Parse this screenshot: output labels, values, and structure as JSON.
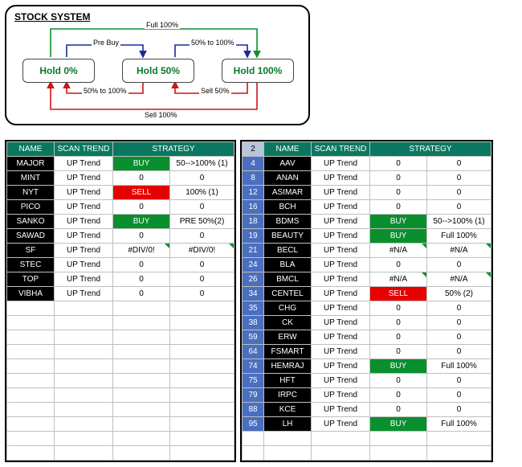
{
  "diagram": {
    "title": "STOCK SYSTEM",
    "states": [
      "Hold 0%",
      "Hold 50%",
      "Hold 100%"
    ],
    "labels": {
      "full": "Full 100%",
      "prebuy": "Pre Buy",
      "fifty_to_hundred_top": "50% to 100%",
      "fifty_to_hundred_bottom": "50% to 100%",
      "sell50": "Sell 50%",
      "sell100": "Sell 100%"
    }
  },
  "left_table": {
    "headers": [
      "NAME",
      "SCAN TREND",
      "STRATEGY"
    ],
    "rows": [
      {
        "name": "MAJOR",
        "trend": "UP Trend",
        "signal": "BUY",
        "arg": "50-->100% (1)"
      },
      {
        "name": "MINT",
        "trend": "UP Trend",
        "signal": "0",
        "arg": "0"
      },
      {
        "name": "NYT",
        "trend": "UP Trend",
        "signal": "SELL",
        "arg": "100% (1)"
      },
      {
        "name": "PICO",
        "trend": "UP Trend",
        "signal": "0",
        "arg": "0"
      },
      {
        "name": "SANKO",
        "trend": "UP Trend",
        "signal": "BUY",
        "arg": "PRE 50%(2)"
      },
      {
        "name": "SAWAD",
        "trend": "UP Trend",
        "signal": "0",
        "arg": "0"
      },
      {
        "name": "SF",
        "trend": "UP Trend",
        "signal": "#DIV/0!",
        "arg": "#DIV/0!",
        "notch": true
      },
      {
        "name": "STEC",
        "trend": "UP Trend",
        "signal": "0",
        "arg": "0"
      },
      {
        "name": "TOP",
        "trend": "UP Trend",
        "signal": "0",
        "arg": "0"
      },
      {
        "name": "VIBHA",
        "trend": "UP Trend",
        "signal": "0",
        "arg": "0"
      }
    ],
    "blank_rows": 11
  },
  "right_table": {
    "headers": [
      "",
      "NAME",
      "SCAN TREND",
      "STRATEGY"
    ],
    "corner": "2",
    "rows": [
      {
        "n": "4",
        "name": "AAV",
        "trend": "UP Trend",
        "signal": "0",
        "arg": "0"
      },
      {
        "n": "8",
        "name": "ANAN",
        "trend": "UP Trend",
        "signal": "0",
        "arg": "0"
      },
      {
        "n": "12",
        "name": "ASIMAR",
        "trend": "UP Trend",
        "signal": "0",
        "arg": "0"
      },
      {
        "n": "16",
        "name": "BCH",
        "trend": "UP Trend",
        "signal": "0",
        "arg": "0"
      },
      {
        "n": "18",
        "name": "BDMS",
        "trend": "UP Trend",
        "signal": "BUY",
        "arg": "50-->100% (1)"
      },
      {
        "n": "19",
        "name": "BEAUTY",
        "trend": "UP Trend",
        "signal": "BUY",
        "arg": "Full 100%"
      },
      {
        "n": "21",
        "name": "BECL",
        "trend": "UP Trend",
        "signal": "#N/A",
        "arg": "#N/A",
        "notch": true
      },
      {
        "n": "24",
        "name": "BLA",
        "trend": "UP Trend",
        "signal": "0",
        "arg": "0"
      },
      {
        "n": "26",
        "name": "BMCL",
        "trend": "UP Trend",
        "signal": "#N/A",
        "arg": "#N/A",
        "notch": true
      },
      {
        "n": "34",
        "name": "CENTEL",
        "trend": "UP Trend",
        "signal": "SELL",
        "arg": "50% (2)"
      },
      {
        "n": "35",
        "name": "CHG",
        "trend": "UP Trend",
        "signal": "0",
        "arg": "0"
      },
      {
        "n": "38",
        "name": "CK",
        "trend": "UP Trend",
        "signal": "0",
        "arg": "0"
      },
      {
        "n": "59",
        "name": "ERW",
        "trend": "UP Trend",
        "signal": "0",
        "arg": "0"
      },
      {
        "n": "64",
        "name": "FSMART",
        "trend": "UP Trend",
        "signal": "0",
        "arg": "0"
      },
      {
        "n": "74",
        "name": "HEMRAJ",
        "trend": "UP Trend",
        "signal": "BUY",
        "arg": "Full 100%"
      },
      {
        "n": "75",
        "name": "HFT",
        "trend": "UP Trend",
        "signal": "0",
        "arg": "0"
      },
      {
        "n": "79",
        "name": "IRPC",
        "trend": "UP Trend",
        "signal": "0",
        "arg": "0"
      },
      {
        "n": "88",
        "name": "KCE",
        "trend": "UP Trend",
        "signal": "0",
        "arg": "0"
      },
      {
        "n": "95",
        "name": "LH",
        "trend": "UP Trend",
        "signal": "BUY",
        "arg": "Full 100%"
      }
    ],
    "blank_rows": 2
  },
  "colors": {
    "arrow_green": "#0a8f2e",
    "arrow_blue": "#1a2a9a",
    "arrow_red": "#d11414"
  }
}
